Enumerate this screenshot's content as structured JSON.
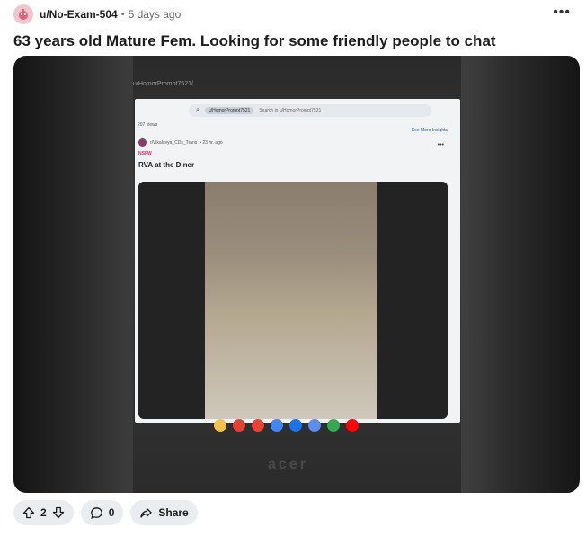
{
  "post": {
    "username": "u/No-Exam-504",
    "separator": "•",
    "time_ago": "5 days ago",
    "more_label": "•••",
    "title": "63 years old Mature Fem. Looking for some friendly people to chat"
  },
  "photo_contents": {
    "laptop_url": "u/HomorPrompt7521/",
    "search_chip": "u/HomorPrompt7521",
    "search_placeholder": "Search in u/HomorPrompt7521",
    "views": "207 views",
    "see_more_insights": "See More Insights",
    "subreddit": "r/Vikalavya_CDs_Trans",
    "inner_time": "• 23 hr. ago",
    "nsfw_tag": "NSFW",
    "inner_title": "RVA at the Diner",
    "laptop_brand": "acer"
  },
  "actions": {
    "upvote_count": "2",
    "comment_count": "0",
    "share_label": "Share"
  },
  "colors": {
    "pill_bg": "#eaedef",
    "meta_text": "#6a6a6a",
    "avatar_bg": "#f3c6cd"
  }
}
